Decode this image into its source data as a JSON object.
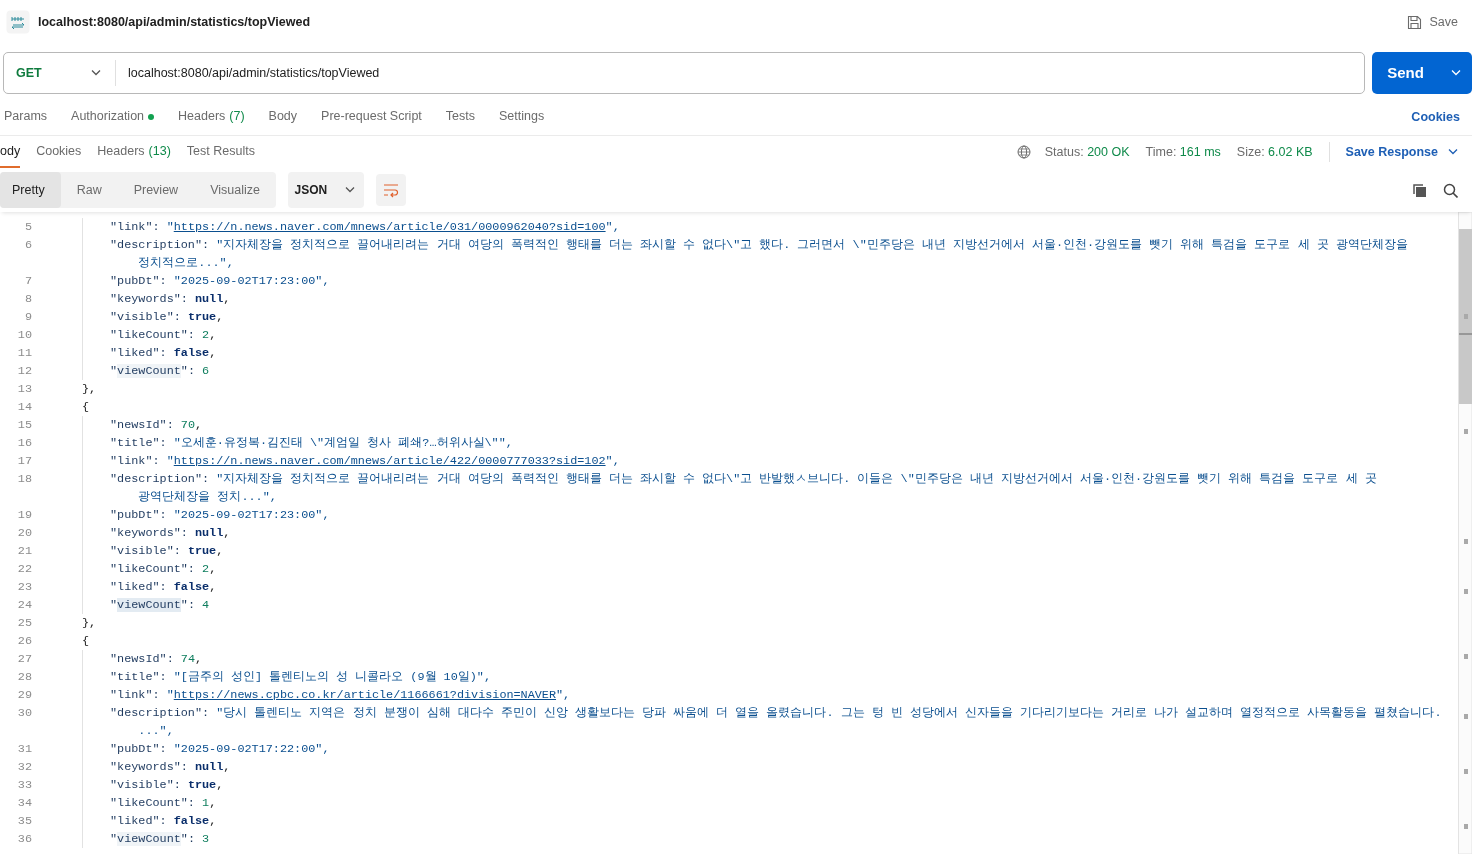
{
  "request": {
    "title": "localhost:8080/api/admin/statistics/topViewed",
    "save_label": "Save",
    "method": "GET",
    "url": "localhost:8080/api/admin/statistics/topViewed",
    "send_label": "Send"
  },
  "request_tabs": [
    {
      "label": "Params",
      "dot": false,
      "selected": false
    },
    {
      "label": "Authorization",
      "dot": true,
      "selected": false
    },
    {
      "label": "Headers",
      "count": "(7)",
      "dot": false,
      "selected": false
    },
    {
      "label": "Body",
      "dot": false,
      "selected": false
    },
    {
      "label": "Pre-request Script",
      "dot": false,
      "selected": false
    },
    {
      "label": "Tests",
      "dot": false,
      "selected": false
    },
    {
      "label": "Settings",
      "dot": false,
      "selected": false
    }
  ],
  "cookies_link": "Cookies",
  "response_tabs": [
    {
      "label": "ody",
      "selected": true
    },
    {
      "label": "Cookies",
      "selected": false
    },
    {
      "label": "Headers",
      "count": "(13)",
      "selected": false
    },
    {
      "label": "Test Results",
      "selected": false
    }
  ],
  "response_status": [
    {
      "label": "Status:",
      "value": "200 OK"
    },
    {
      "label": "Time:",
      "value": "161 ms"
    },
    {
      "label": "Size:",
      "value": "6.02 KB"
    }
  ],
  "save_response": "Save Response",
  "view_modes": [
    {
      "label": "Pretty",
      "selected": true
    },
    {
      "label": "Raw",
      "selected": false
    },
    {
      "label": "Preview",
      "selected": false
    },
    {
      "label": "Visualize",
      "selected": false
    }
  ],
  "format": "JSON",
  "wrap_lines": true,
  "code_lines": [
    {
      "no": "5",
      "kind": "field",
      "parts": [
        {
          "t": "\"link\": ",
          "kind": "key"
        },
        {
          "t": "\"",
          "kind": "str"
        },
        {
          "t": "https://n.news.naver.com/mnews/article/031/0000962040?sid=100",
          "kind": "link"
        },
        {
          "t": "\",",
          "kind": "str"
        }
      ]
    },
    {
      "no": "6",
      "kind": "field",
      "parts": [
        {
          "t": "\"description\": ",
          "kind": "key"
        },
        {
          "t": "\"지자체장을 정치적으로 끌어내리려는 거대 여당의 폭력적인 행태를 더는 좌시할 수 없다\\\"고 했다. 그러면서 \\\"민주당은 내년 지방선거에서 서울·인천·강원도를 뺏기 위해 특검을 도구로 세 곳 광역단체장을 정치적으로...\",",
          "kind": "str"
        }
      ]
    },
    {
      "no": "7",
      "kind": "field",
      "parts": [
        {
          "t": "\"pubDt\": ",
          "kind": "key"
        },
        {
          "t": "\"2025-09-02T17:23:00\",",
          "kind": "str"
        }
      ]
    },
    {
      "no": "8",
      "kind": "field",
      "parts": [
        {
          "t": "\"keywords\": ",
          "kind": "key"
        },
        {
          "t": "null",
          "kind": "lit"
        },
        {
          "t": ",",
          "kind": "punct"
        }
      ]
    },
    {
      "no": "9",
      "kind": "field",
      "parts": [
        {
          "t": "\"visible\": ",
          "kind": "key"
        },
        {
          "t": "true",
          "kind": "lit"
        },
        {
          "t": ",",
          "kind": "punct"
        }
      ]
    },
    {
      "no": "10",
      "kind": "field",
      "parts": [
        {
          "t": "\"likeCount\": ",
          "kind": "key"
        },
        {
          "t": "2",
          "kind": "num"
        },
        {
          "t": ",",
          "kind": "punct"
        }
      ]
    },
    {
      "no": "11",
      "kind": "field",
      "parts": [
        {
          "t": "\"liked\": ",
          "kind": "key"
        },
        {
          "t": "false",
          "kind": "lit"
        },
        {
          "t": ",",
          "kind": "punct"
        }
      ]
    },
    {
      "no": "12",
      "kind": "field",
      "parts": [
        {
          "t": "\"",
          "kind": "key"
        },
        {
          "t": "viewCount",
          "kind": "key",
          "highlighted": true,
          "selected": false
        },
        {
          "t": "\": ",
          "kind": "key"
        },
        {
          "t": "6",
          "kind": "num"
        }
      ]
    },
    {
      "no": "13",
      "kind": "brace",
      "parts": [
        {
          "t": "},",
          "kind": "punct"
        }
      ]
    },
    {
      "no": "14",
      "kind": "brace",
      "parts": [
        {
          "t": "{",
          "kind": "punct"
        }
      ]
    },
    {
      "no": "15",
      "kind": "field",
      "parts": [
        {
          "t": "\"newsId\": ",
          "kind": "key"
        },
        {
          "t": "70",
          "kind": "num"
        },
        {
          "t": ",",
          "kind": "punct"
        }
      ]
    },
    {
      "no": "16",
      "kind": "field",
      "parts": [
        {
          "t": "\"title\": ",
          "kind": "key"
        },
        {
          "t": "\"오세훈·유정복·김진태 \\\"계엄일 청사 폐쇄?…허위사실\\\"\",",
          "kind": "str"
        }
      ]
    },
    {
      "no": "17",
      "kind": "field",
      "parts": [
        {
          "t": "\"link\": ",
          "kind": "key"
        },
        {
          "t": "\"",
          "kind": "str"
        },
        {
          "t": "https://n.news.naver.com/mnews/article/422/0000777033?sid=102",
          "kind": "link"
        },
        {
          "t": "\",",
          "kind": "str"
        }
      ]
    },
    {
      "no": "18",
      "kind": "field",
      "parts": [
        {
          "t": "\"description\": ",
          "kind": "key"
        },
        {
          "t": "\"지자체장을 정치적으로 끌어내리려는 거대 여당의 폭력적인 행태를 더는 좌시할 수 없다\\\"고 반발했ㅅ브니다. 이들은 \\\"민주당은 내년 지방선거에서 서울·인천·강원도를 뺏기 위해 특검을 도구로 세 곳 광역단체장을 정치...\",",
          "kind": "str"
        }
      ]
    },
    {
      "no": "19",
      "kind": "field",
      "parts": [
        {
          "t": "\"pubDt\": ",
          "kind": "key"
        },
        {
          "t": "\"2025-09-02T17:23:00\",",
          "kind": "str"
        }
      ]
    },
    {
      "no": "20",
      "kind": "field",
      "parts": [
        {
          "t": "\"keywords\": ",
          "kind": "key"
        },
        {
          "t": "null",
          "kind": "lit"
        },
        {
          "t": ",",
          "kind": "punct"
        }
      ]
    },
    {
      "no": "21",
      "kind": "field",
      "parts": [
        {
          "t": "\"visible\": ",
          "kind": "key"
        },
        {
          "t": "true",
          "kind": "lit"
        },
        {
          "t": ",",
          "kind": "punct"
        }
      ]
    },
    {
      "no": "22",
      "kind": "field",
      "parts": [
        {
          "t": "\"likeCount\": ",
          "kind": "key"
        },
        {
          "t": "2",
          "kind": "num"
        },
        {
          "t": ",",
          "kind": "punct"
        }
      ]
    },
    {
      "no": "23",
      "kind": "field",
      "parts": [
        {
          "t": "\"liked\": ",
          "kind": "key"
        },
        {
          "t": "false",
          "kind": "lit"
        },
        {
          "t": ",",
          "kind": "punct"
        }
      ]
    },
    {
      "no": "24",
      "kind": "field",
      "parts": [
        {
          "t": "\"",
          "kind": "key"
        },
        {
          "t": "viewCount",
          "kind": "key",
          "highlighted": true,
          "selected": true
        },
        {
          "t": "\": ",
          "kind": "key"
        },
        {
          "t": "4",
          "kind": "num"
        }
      ]
    },
    {
      "no": "25",
      "kind": "brace",
      "parts": [
        {
          "t": "},",
          "kind": "punct"
        }
      ]
    },
    {
      "no": "26",
      "kind": "brace",
      "parts": [
        {
          "t": "{",
          "kind": "punct"
        }
      ]
    },
    {
      "no": "27",
      "kind": "field",
      "parts": [
        {
          "t": "\"newsId\": ",
          "kind": "key"
        },
        {
          "t": "74",
          "kind": "num"
        },
        {
          "t": ",",
          "kind": "punct"
        }
      ]
    },
    {
      "no": "28",
      "kind": "field",
      "parts": [
        {
          "t": "\"title\": ",
          "kind": "key"
        },
        {
          "t": "\"[금주의 성인] 톨렌티노의 성 니콜라오 (9월 10일)\",",
          "kind": "str"
        }
      ]
    },
    {
      "no": "29",
      "kind": "field",
      "parts": [
        {
          "t": "\"link\": ",
          "kind": "key"
        },
        {
          "t": "\"",
          "kind": "str"
        },
        {
          "t": "https://news.cpbc.co.kr/article/1166661?division=NAVER",
          "kind": "link"
        },
        {
          "t": "\",",
          "kind": "str"
        }
      ]
    },
    {
      "no": "30",
      "kind": "field",
      "parts": [
        {
          "t": "\"description\": ",
          "kind": "key"
        },
        {
          "t": "\"당시 톨렌티노 지역은 정치 분쟁이 심해 대다수 주민이 신앙 생활보다는 당파 싸움에 더 열을 올렸습니다. 그는 텅 빈 성당에서 신자들을 기다리기보다는 거리로 나가 설교하며 열정적으로 사목활동을 펼쳤습니다. ...\",",
          "kind": "str"
        }
      ]
    },
    {
      "no": "31",
      "kind": "field",
      "parts": [
        {
          "t": "\"pubDt\": ",
          "kind": "key"
        },
        {
          "t": "\"2025-09-02T17:22:00\",",
          "kind": "str"
        }
      ]
    },
    {
      "no": "32",
      "kind": "field",
      "parts": [
        {
          "t": "\"keywords\": ",
          "kind": "key"
        },
        {
          "t": "null",
          "kind": "lit"
        },
        {
          "t": ",",
          "kind": "punct"
        }
      ]
    },
    {
      "no": "33",
      "kind": "field",
      "parts": [
        {
          "t": "\"visible\": ",
          "kind": "key"
        },
        {
          "t": "true",
          "kind": "lit"
        },
        {
          "t": ",",
          "kind": "punct"
        }
      ]
    },
    {
      "no": "34",
      "kind": "field",
      "parts": [
        {
          "t": "\"likeCount\": ",
          "kind": "key"
        },
        {
          "t": "1",
          "kind": "num"
        },
        {
          "t": ",",
          "kind": "punct"
        }
      ]
    },
    {
      "no": "35",
      "kind": "field",
      "parts": [
        {
          "t": "\"liked\": ",
          "kind": "key"
        },
        {
          "t": "false",
          "kind": "lit"
        },
        {
          "t": ",",
          "kind": "punct"
        }
      ]
    },
    {
      "no": "36",
      "kind": "field",
      "parts": [
        {
          "t": "\"",
          "kind": "key"
        },
        {
          "t": "viewCount",
          "kind": "key",
          "highlighted": true,
          "selected": false
        },
        {
          "t": "\": ",
          "kind": "key"
        },
        {
          "t": "3",
          "kind": "num"
        }
      ]
    }
  ]
}
